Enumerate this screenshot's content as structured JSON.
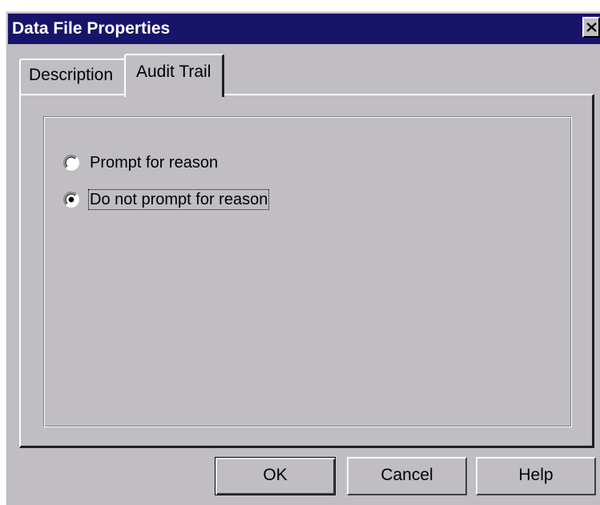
{
  "window": {
    "title": "Data File Properties",
    "close_symbol": "close-icon"
  },
  "tabs": [
    {
      "label": "Description",
      "selected": false
    },
    {
      "label": "Audit Trail",
      "selected": true
    }
  ],
  "audit_trail": {
    "options": [
      {
        "label": "Prompt for reason",
        "checked": false
      },
      {
        "label": "Do not prompt for reason",
        "checked": true,
        "focused": true
      }
    ]
  },
  "buttons": {
    "ok": "OK",
    "cancel": "Cancel",
    "help": "Help"
  },
  "colors": {
    "titlebar": "#17146a",
    "face": "#c0bec3",
    "title_text": "#ffffff"
  }
}
